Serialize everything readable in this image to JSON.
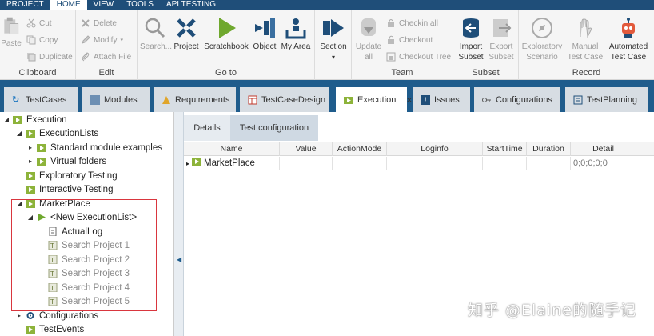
{
  "menu": {
    "tabs": [
      "PROJECT",
      "HOME",
      "VIEW",
      "TOOLS",
      "API TESTING"
    ]
  },
  "ribbon": {
    "clipboard": {
      "paste": "Paste",
      "cut": "Cut",
      "copy": "Copy",
      "duplicate": "Duplicate",
      "label": "Clipboard"
    },
    "edit": {
      "delete": "Delete",
      "modify": "Modify",
      "attach": "Attach File",
      "label": "Edit"
    },
    "goto": {
      "search": "Search...",
      "project": "Project",
      "scratchbook": "Scratchbook",
      "object": "Object",
      "myarea": "My Area",
      "label": "Go to"
    },
    "section": {
      "label": "Section"
    },
    "team": {
      "update_line1": "Update",
      "update_line2": "all",
      "checkin_all": "Checkin all",
      "checkout": "Checkout",
      "checkout_tree": "Checkout Tree",
      "label": "Team"
    },
    "subset": {
      "import_line1": "Import",
      "import_line2": "Subset",
      "export_line1": "Export",
      "export_line2": "Subset",
      "label": "Subset"
    },
    "record": {
      "exploratory_line1": "Exploratory",
      "exploratory_line2": "Scenario",
      "manual_line1": "Manual",
      "manual_line2": "Test Case",
      "automated_line1": "Automated",
      "automated_line2": "Test Case",
      "label": "Record"
    }
  },
  "doc_tabs": {
    "testcases": "TestCases",
    "modules": "Modules",
    "requirements": "Requirements",
    "testcasedesign": "TestCaseDesign",
    "execution": "Execution",
    "close": "×",
    "issues": "Issues",
    "configurations": "Configurations",
    "testplanning": "TestPlanning"
  },
  "tree": {
    "execution": "Execution",
    "executionlists": "ExecutionLists",
    "standard_module_examples": "Standard module examples",
    "virtual_folders": "Virtual folders",
    "exploratory_testing": "Exploratory Testing",
    "interactive_testing": "Interactive Testing",
    "marketplace": "MarketPlace",
    "new_executionlist": "<New ExecutionList>",
    "actuallog": "ActualLog",
    "search1": "Search Project 1",
    "search2": "Search Project 2",
    "search3": "Search Project 3",
    "search4": "Search Project 4",
    "search5": "Search Project 5",
    "configurations": "Configurations",
    "testevents": "TestEvents"
  },
  "detail": {
    "tabs": {
      "details": "Details",
      "test_configuration": "Test configuration"
    },
    "columns": {
      "name": "Name",
      "value": "Value",
      "actionmode": "ActionMode",
      "loginfo": "Loginfo",
      "starttime": "StartTime",
      "duration": "Duration",
      "detail": "Detail"
    },
    "row": {
      "name": "MarketPlace",
      "detail": "0;0;0;0;0"
    }
  },
  "watermark": "知乎 @Elaine的随手记",
  "colors": {
    "menu_bar": "#1f4e79",
    "tab_bar": "#1f5c8c",
    "folder_green": "#8db33a",
    "highlight_red": "#d9363e"
  }
}
